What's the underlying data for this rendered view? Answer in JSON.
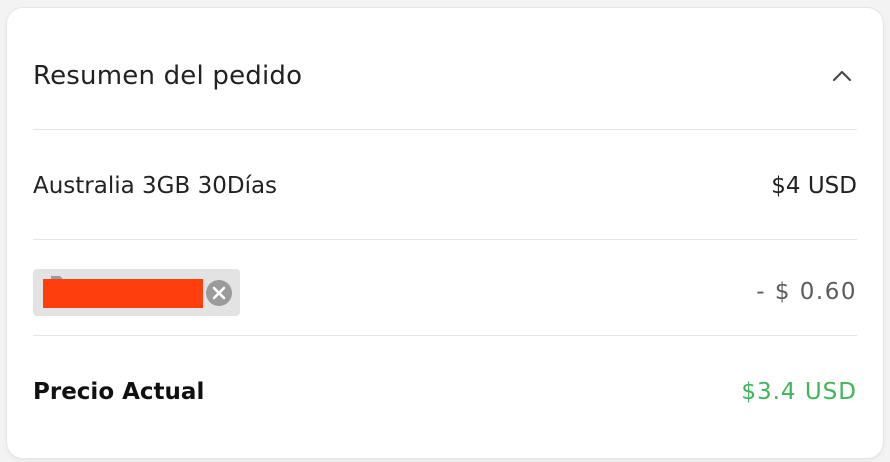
{
  "summary": {
    "title": "Resumen del pedido",
    "toggle_icon": "chevron-up-icon"
  },
  "item": {
    "name": "Australia 3GB 30Días",
    "price": "$4 USD"
  },
  "coupon": {
    "code": "",
    "tag_icon": "tag-icon",
    "remove_icon": "close-circle-icon",
    "discount": "- $ 0.60"
  },
  "total": {
    "label": "Precio Actual",
    "value": "$3.4 USD"
  },
  "colors": {
    "total_value": "#3fb55a",
    "redaction": "#ff3d0d",
    "chip_background": "#e3e3e3"
  }
}
